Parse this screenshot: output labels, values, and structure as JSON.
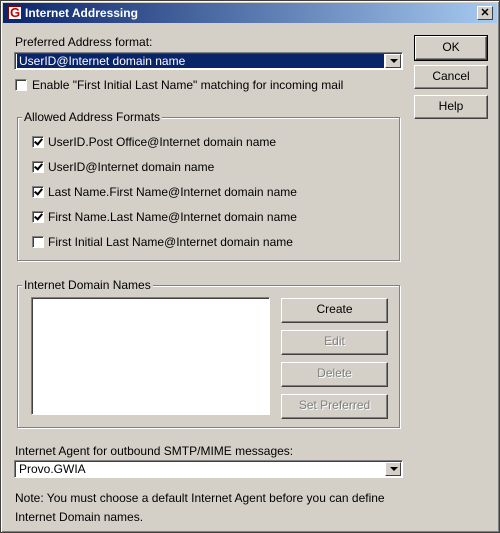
{
  "window": {
    "title": "Internet Addressing",
    "app_icon_letter": "G",
    "close_glyph": "✕"
  },
  "preferred": {
    "label": "Preferred Address format:",
    "value": "UserID@Internet domain name",
    "enable_label": "Enable \"First Initial Last Name\" matching for incoming mail",
    "enable_checked": false
  },
  "allowed": {
    "title": "Allowed Address Formats",
    "items": [
      {
        "label": "UserID.Post Office@Internet domain name",
        "checked": true
      },
      {
        "label": "UserID@Internet domain name",
        "checked": true
      },
      {
        "label": "Last Name.First Name@Internet domain name",
        "checked": true
      },
      {
        "label": "First Name.Last Name@Internet domain name",
        "checked": true
      },
      {
        "label": "First Initial Last Name@Internet domain name",
        "checked": false
      }
    ]
  },
  "domains": {
    "title": "Internet Domain Names",
    "items": [],
    "create_label": "Create",
    "edit_label": "Edit",
    "delete_label": "Delete",
    "set_preferred_label": "Set Preferred"
  },
  "agent": {
    "label": "Internet Agent for outbound SMTP/MIME messages:",
    "value": "Provo.GWIA"
  },
  "note": {
    "line1": "Note:  You must choose a default Internet Agent before you can define",
    "line2": "Internet Domain names."
  },
  "buttons": {
    "ok": "OK",
    "cancel": "Cancel",
    "help": "Help"
  }
}
